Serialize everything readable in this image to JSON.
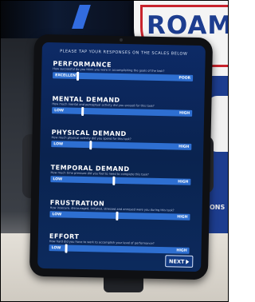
{
  "background": {
    "sign_text": "ROAM",
    "side_text": "ONS"
  },
  "survey": {
    "prompt": "PLEASE TAP YOUR RESPONSES ON THE SCALES BELOW",
    "sections": [
      {
        "title": "PERFORMANCE",
        "question": "How successful do you think you were in accomplishing the goals of the task?",
        "low_label": "EXCELLENT",
        "high_label": "POOR",
        "value": 0.18
      },
      {
        "title": "MENTAL DEMAND",
        "question": "How much mental and perceptual activity did you exceed for this task?",
        "low_label": "LOW",
        "high_label": "HIGH",
        "value": 0.22
      },
      {
        "title": "PHYSICAL DEMAND",
        "question": "How much physical activity did you spend for this task?",
        "low_label": "LOW",
        "high_label": "HIGH",
        "value": 0.28
      },
      {
        "title": "TEMPORAL DEMAND",
        "question": "How much time pressure did you feel to need to complete this task?",
        "low_label": "LOW",
        "high_label": "HIGH",
        "value": 0.45
      },
      {
        "title": "FRUSTRATION",
        "question": "How insecure, discouraged, irritated, stressed and annoyed were you during this task?",
        "low_label": "LOW",
        "high_label": "HIGH",
        "value": 0.48
      },
      {
        "title": "EFFORT",
        "question": "How hard did you have to work to accomplish your level of performance?",
        "low_label": "LOW",
        "high_label": "HIGH",
        "value": 0.12
      }
    ],
    "next_label": "NEXT"
  },
  "colors": {
    "screen_bg": "#0d2a66",
    "bar": "#2e6fd1",
    "sign_red": "#c8232c",
    "sign_blue": "#1d3d8f"
  }
}
